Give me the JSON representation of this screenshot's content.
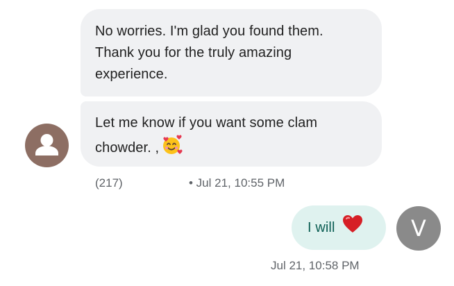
{
  "conversation": {
    "incoming": {
      "message_1": {
        "line_1": "No worries. I'm glad you found them.",
        "line_2": "Thank you for the truly amazing",
        "line_3": "experience."
      },
      "message_2": {
        "line_1": "Let me know if you want some clam",
        "line_2": "chowder. ,",
        "emoji": "smiling-face-with-hearts",
        "char_count": "(217)",
        "timestamp": "• Jul 21, 10:55 PM"
      },
      "avatar_icon": "person-icon",
      "avatar_color": "#8d6e63"
    },
    "outgoing": {
      "message_3": {
        "text": "I will",
        "emoji": "red-heart",
        "timestamp": "Jul 21, 10:58 PM"
      },
      "avatar_initial": "V",
      "avatar_color": "#8a8a8a"
    }
  },
  "colors": {
    "incoming_bubble": "#f0f1f3",
    "outgoing_bubble": "#dff2ef",
    "outgoing_text": "#0b5e53",
    "meta_text": "#5f6368"
  }
}
